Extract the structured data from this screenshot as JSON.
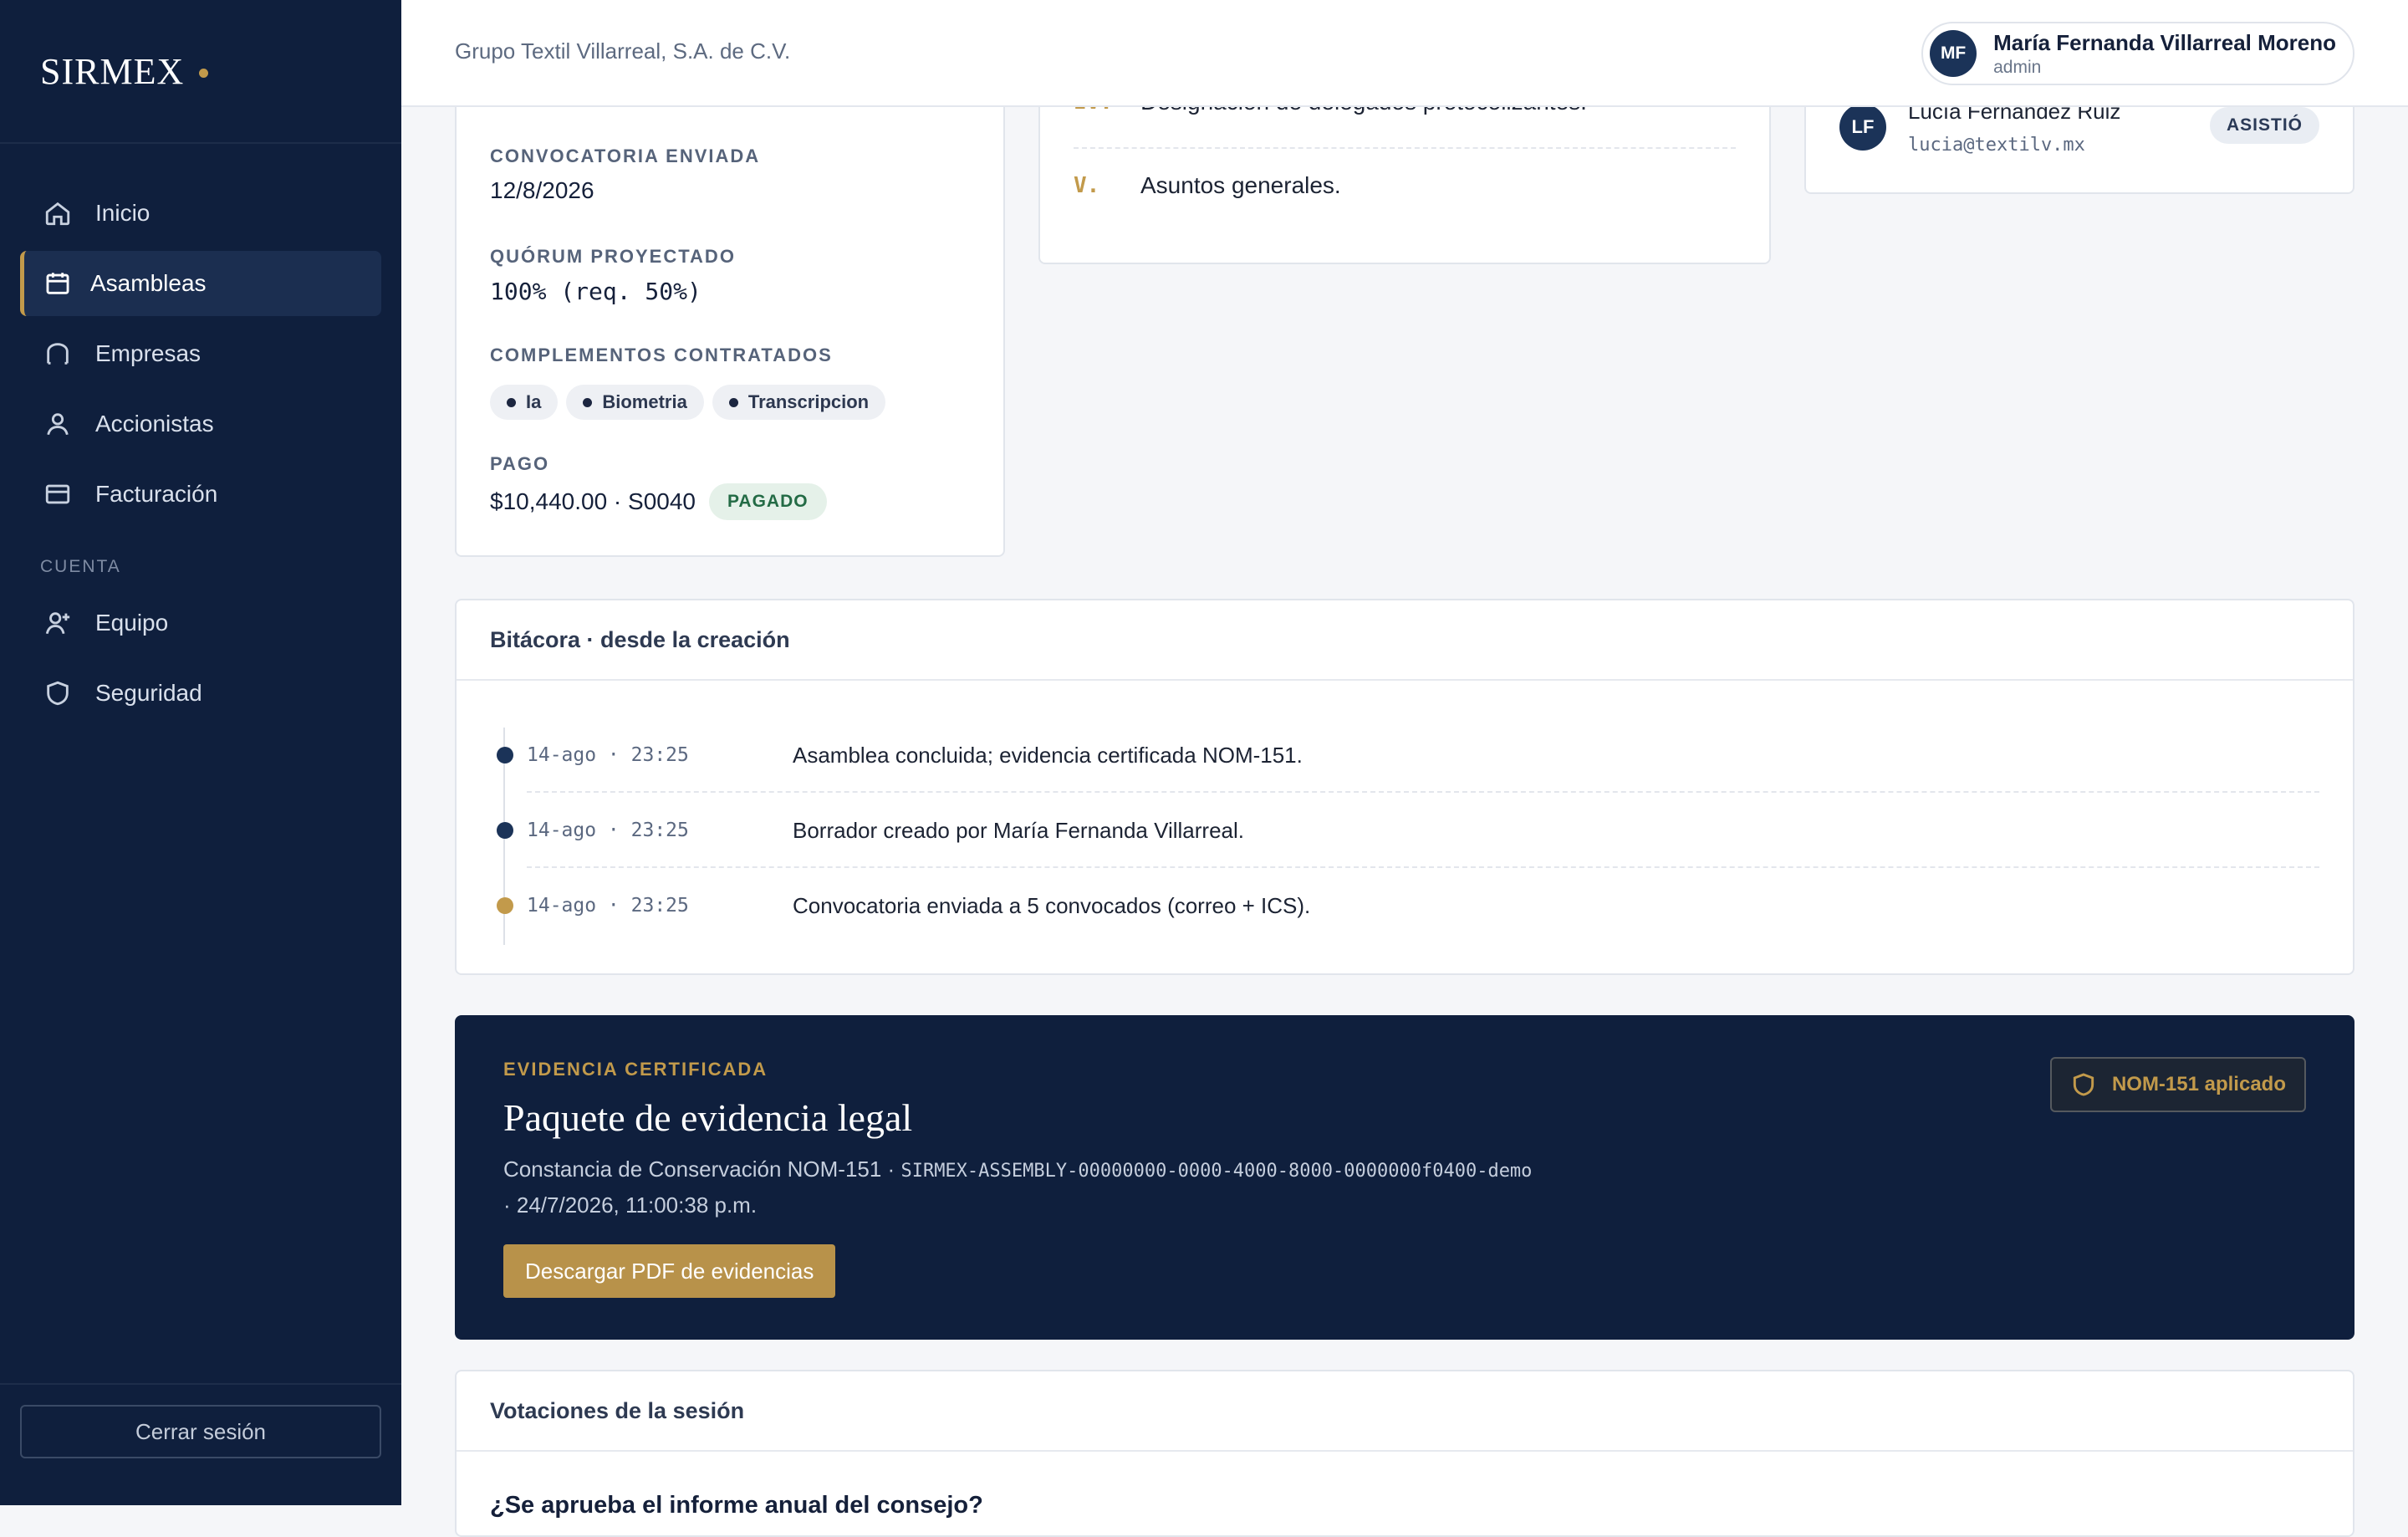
{
  "sidebar": {
    "brand": "SIRMEX",
    "nav": [
      {
        "label": "Inicio",
        "icon": "home-icon"
      },
      {
        "label": "Asambleas",
        "icon": "calendar-icon",
        "active": true
      },
      {
        "label": "Empresas",
        "icon": "building-icon"
      },
      {
        "label": "Accionistas",
        "icon": "user-icon"
      },
      {
        "label": "Facturación",
        "icon": "credit-card-icon"
      }
    ],
    "section_label": "CUENTA",
    "account_nav": [
      {
        "label": "Equipo",
        "icon": "user-plus-icon"
      },
      {
        "label": "Seguridad",
        "icon": "shield-icon"
      }
    ],
    "logout": "Cerrar sesión"
  },
  "header": {
    "company": "Grupo Textil Villarreal, S.A. de C.V.",
    "user": {
      "initials": "MF",
      "name": "María Fernanda Villarreal Moreno",
      "role": "admin"
    }
  },
  "summary": {
    "convocatoria_label": "CONVOCATORIA ENVIADA",
    "convocatoria_value": "12/8/2026",
    "quorum_label": "QUÓRUM PROYECTADO",
    "quorum_value": "100% (req. 50%)",
    "complementos_label": "COMPLEMENTOS CONTRATADOS",
    "complementos": [
      "Ia",
      "Biometria",
      "Transcripcion"
    ],
    "pago_label": "PAGO",
    "pago_value": "$10,440.00 · S0040",
    "pago_status": "PAGADO"
  },
  "agenda": {
    "items": [
      {
        "num": "IV.",
        "text": "Designación de delegados protocolizantes."
      },
      {
        "num": "V.",
        "text": "Asuntos generales."
      }
    ]
  },
  "attendee": {
    "initials": "LF",
    "name": "Lucía Fernández Ruiz",
    "email": "lucia@textilv.mx",
    "status": "ASISTIÓ"
  },
  "log": {
    "title": "Bitácora · desde la creación",
    "entries": [
      {
        "time": "14-ago · 23:25",
        "text": "Asamblea concluida; evidencia certificada NOM-151."
      },
      {
        "time": "14-ago · 23:25",
        "text": "Borrador creado por María Fernanda Villarreal."
      },
      {
        "time": "14-ago · 23:25",
        "text": "Convocatoria enviada a 5 convocados (correo + ICS)."
      }
    ]
  },
  "evidence": {
    "kicker": "EVIDENCIA CERTIFICADA",
    "title": "Paquete de evidencia legal",
    "desc_prefix": "Constancia de Conservación NOM-151 · ",
    "desc_code": "SIRMEX-ASSEMBLY-00000000-0000-4000-8000-0000000f0400-demo",
    "desc_suffix": "· 24/7/2026, 11:00:38 p.m.",
    "button": "Descargar PDF de evidencias",
    "badge": "NOM-151 aplicado"
  },
  "votes": {
    "title": "Votaciones de la sesión",
    "first_question": "¿Se aprueba el informe anual del consejo?"
  },
  "colors": {
    "sidebar_bg": "#0f1f3d",
    "accent_gold": "#c29a4b",
    "paid_green": "#236b45"
  }
}
